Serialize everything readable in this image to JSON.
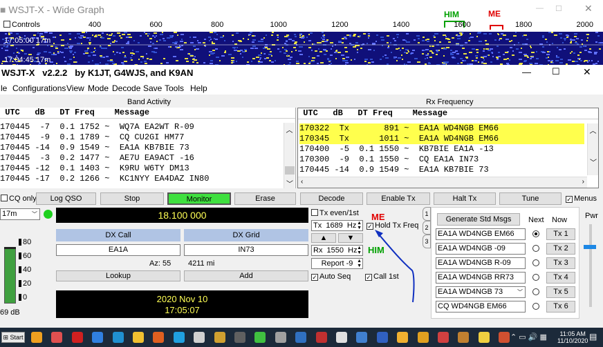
{
  "wide_graph": {
    "title": "WSJT-X - Wide Graph",
    "controls": "Controls",
    "ticks": [
      "400",
      "600",
      "800",
      "1000",
      "1200",
      "1400",
      "1600",
      "1800",
      "2000"
    ],
    "time_label": "17:05:00  17m",
    "time_label2": "17:04:45  17m",
    "him": "HIM",
    "me": "ME"
  },
  "main": {
    "title": "WSJT-X   v2.2.2   by K1JT, G4WJS, and K9AN",
    "menus": [
      "le",
      "Configurations",
      "View",
      "Mode",
      "Decode",
      "Save",
      "Tools",
      "Help"
    ]
  },
  "band_activity": {
    "label": "Band Activity",
    "header": " UTC   dB   DT Freq    Message",
    "rows": [
      "170445  -7  0.1 1752 ~  WQ7A EA2WT R-09",
      "170445  -9  0.1 1789 ~  CQ CU2GI HM77",
      "170445 -14  0.9 1549 ~  EA1A KB7BIE 73",
      "170445  -3  0.2 1477 ~  AE7U EA9ACT -16",
      "170445 -12  0.1 1403 ~  K9RU W6TY DM13",
      "170445 -17  0.2 1266 ~  KC1NYY EA4DAZ IN80"
    ]
  },
  "rx_frequency": {
    "label": "Rx Frequency",
    "header": " UTC   dB   DT Freq    Message",
    "rows": [
      {
        "text": "170322  Tx       891 ~  EA1A WD4NGB EM66",
        "hl": true
      },
      {
        "text": "170345  Tx      1011 ~  EA1A WD4NGB EM66",
        "hl": true
      },
      {
        "text": "170400  -5  0.1 1550 ~  KB7BIE EA1A -13",
        "hl": false
      },
      {
        "text": "170300  -9  0.1 1550 ~  CQ EA1A IN73",
        "hl": false
      },
      {
        "text": "170445 -14  0.9 1549 ~  EA1A KB7BIE 73",
        "hl": false
      }
    ]
  },
  "buttons": {
    "cq_only": "CQ only",
    "log_qso": "Log QSO",
    "stop": "Stop",
    "monitor": "Monitor",
    "erase": "Erase",
    "decode": "Decode",
    "enable_tx": "Enable Tx",
    "halt_tx": "Halt Tx",
    "tune": "Tune",
    "menus": "Menus",
    "lookup": "Lookup",
    "add": "Add",
    "gen_msgs": "Generate Std Msgs"
  },
  "controls": {
    "band": "17m",
    "frequency": "18.100 000",
    "dx_call_label": "DX Call",
    "dx_grid_label": "DX Grid",
    "dx_call": "EA1A",
    "dx_grid": "IN73",
    "az": "Az: 55",
    "dist": "4211 mi",
    "date": "2020 Nov 10",
    "time": "17:05:07",
    "meter_ticks": [
      "80",
      "60",
      "40",
      "20",
      "0"
    ],
    "meter_db": "69 dB"
  },
  "tx": {
    "tx_even": "Tx even/1st",
    "tx_freq": "Tx  1689  Hz",
    "hold": "Hold Tx Freq",
    "rx_freq": "Rx  1550  Hz",
    "report": "Report -9",
    "auto_seq": "Auto Seq",
    "call_1st": "Call 1st",
    "me": "ME",
    "him": "HIM",
    "next": "Next",
    "now": "Now",
    "pwr": "Pwr",
    "tab1": "1",
    "tab2": "2",
    "tab3": "3",
    "messages": [
      "EA1A WD4NGB EM66",
      "EA1A WD4NGB -09",
      "EA1A WD4NGB R-09",
      "EA1A WD4NGB RR73",
      "EA1A WD4NGB 73",
      "CQ WD4NGB EM66"
    ],
    "tx_labels": [
      "Tx 1",
      "Tx 2",
      "Tx 3",
      "Tx 4",
      "Tx 5",
      "Tx 6"
    ]
  },
  "taskbar": {
    "start": "Start",
    "time": "11:05 AM",
    "date": "11/10/2020"
  },
  "colors": {
    "highlight": "#ffff4d",
    "monitor": "#3fe03f",
    "him": "#00a000",
    "me": "#e00000",
    "arrow": "#1030c0",
    "waterfall": "#10107a"
  }
}
